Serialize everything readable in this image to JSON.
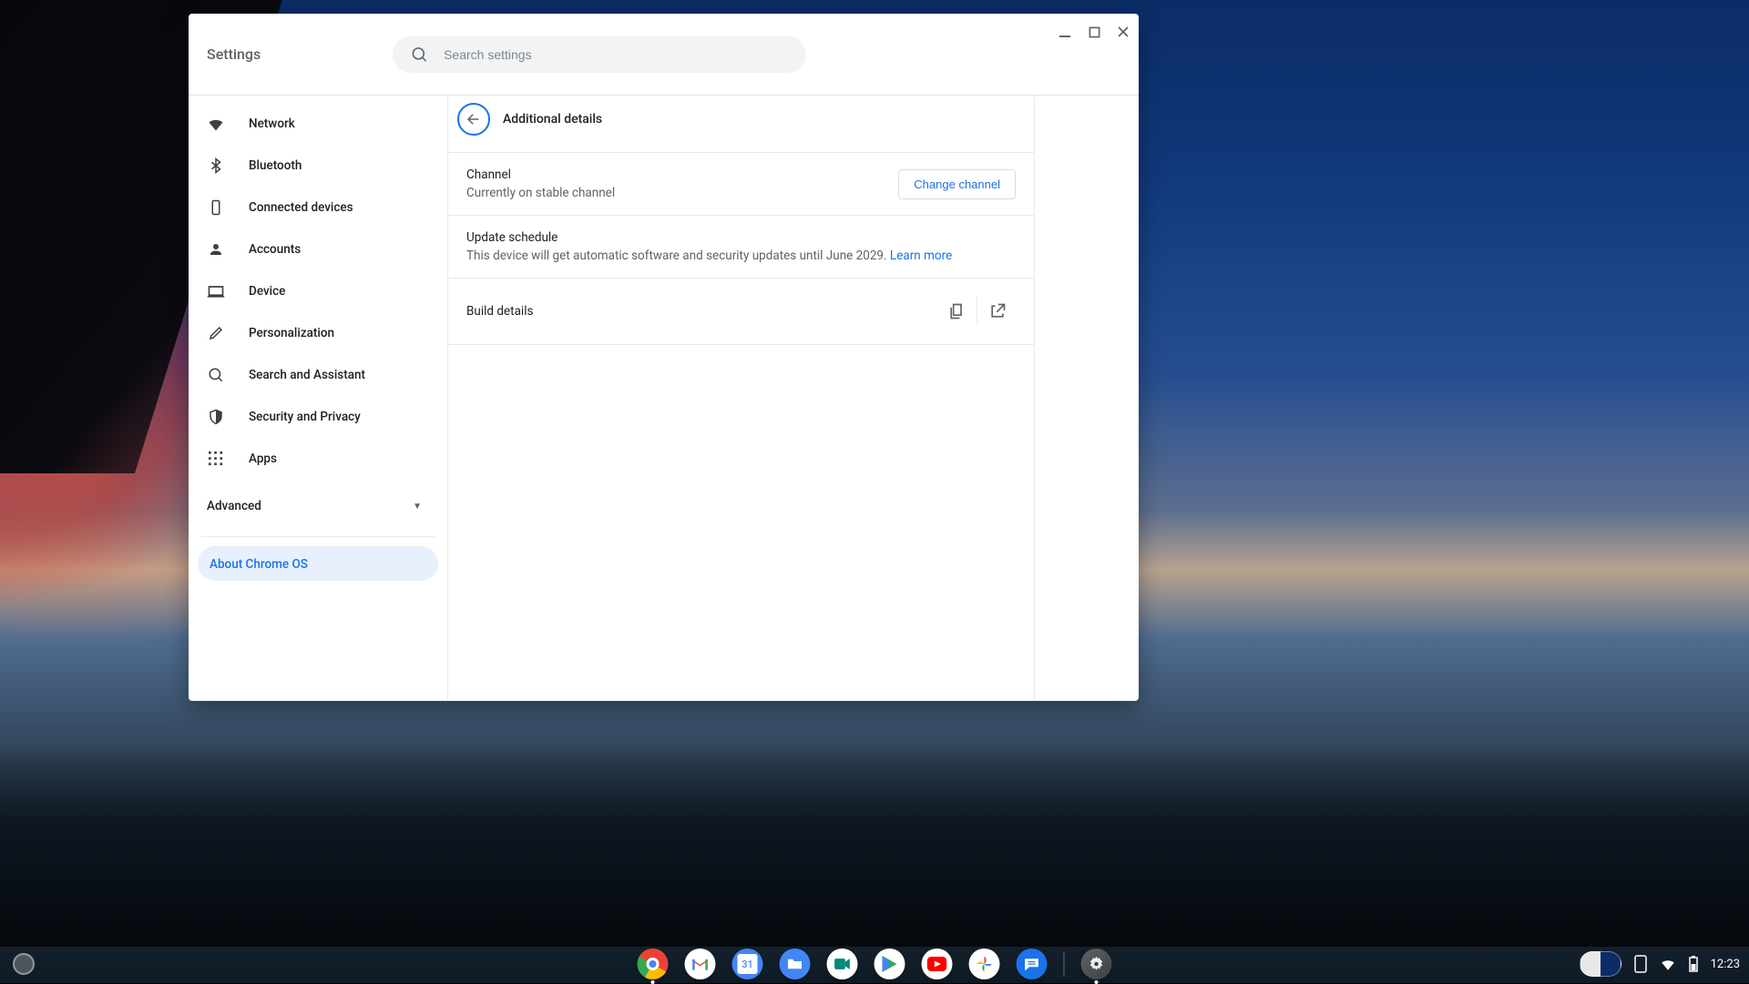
{
  "header": {
    "title": "Settings",
    "search_placeholder": "Search settings"
  },
  "sidebar": {
    "items": [
      {
        "label": "Network"
      },
      {
        "label": "Bluetooth"
      },
      {
        "label": "Connected devices"
      },
      {
        "label": "Accounts"
      },
      {
        "label": "Device"
      },
      {
        "label": "Personalization"
      },
      {
        "label": "Search and Assistant"
      },
      {
        "label": "Security and Privacy"
      },
      {
        "label": "Apps"
      }
    ],
    "advanced_label": "Advanced",
    "about_label": "About Chrome OS"
  },
  "main": {
    "page_title": "Additional details",
    "channel": {
      "title": "Channel",
      "subtitle": "Currently on stable channel",
      "button": "Change channel"
    },
    "update": {
      "title": "Update schedule",
      "subtitle": "This device will get automatic software and security updates until June 2029. ",
      "learn_more": "Learn more"
    },
    "build": {
      "title": "Build details"
    }
  },
  "shelf": {
    "calendar_day": "31",
    "time": "12:23"
  }
}
